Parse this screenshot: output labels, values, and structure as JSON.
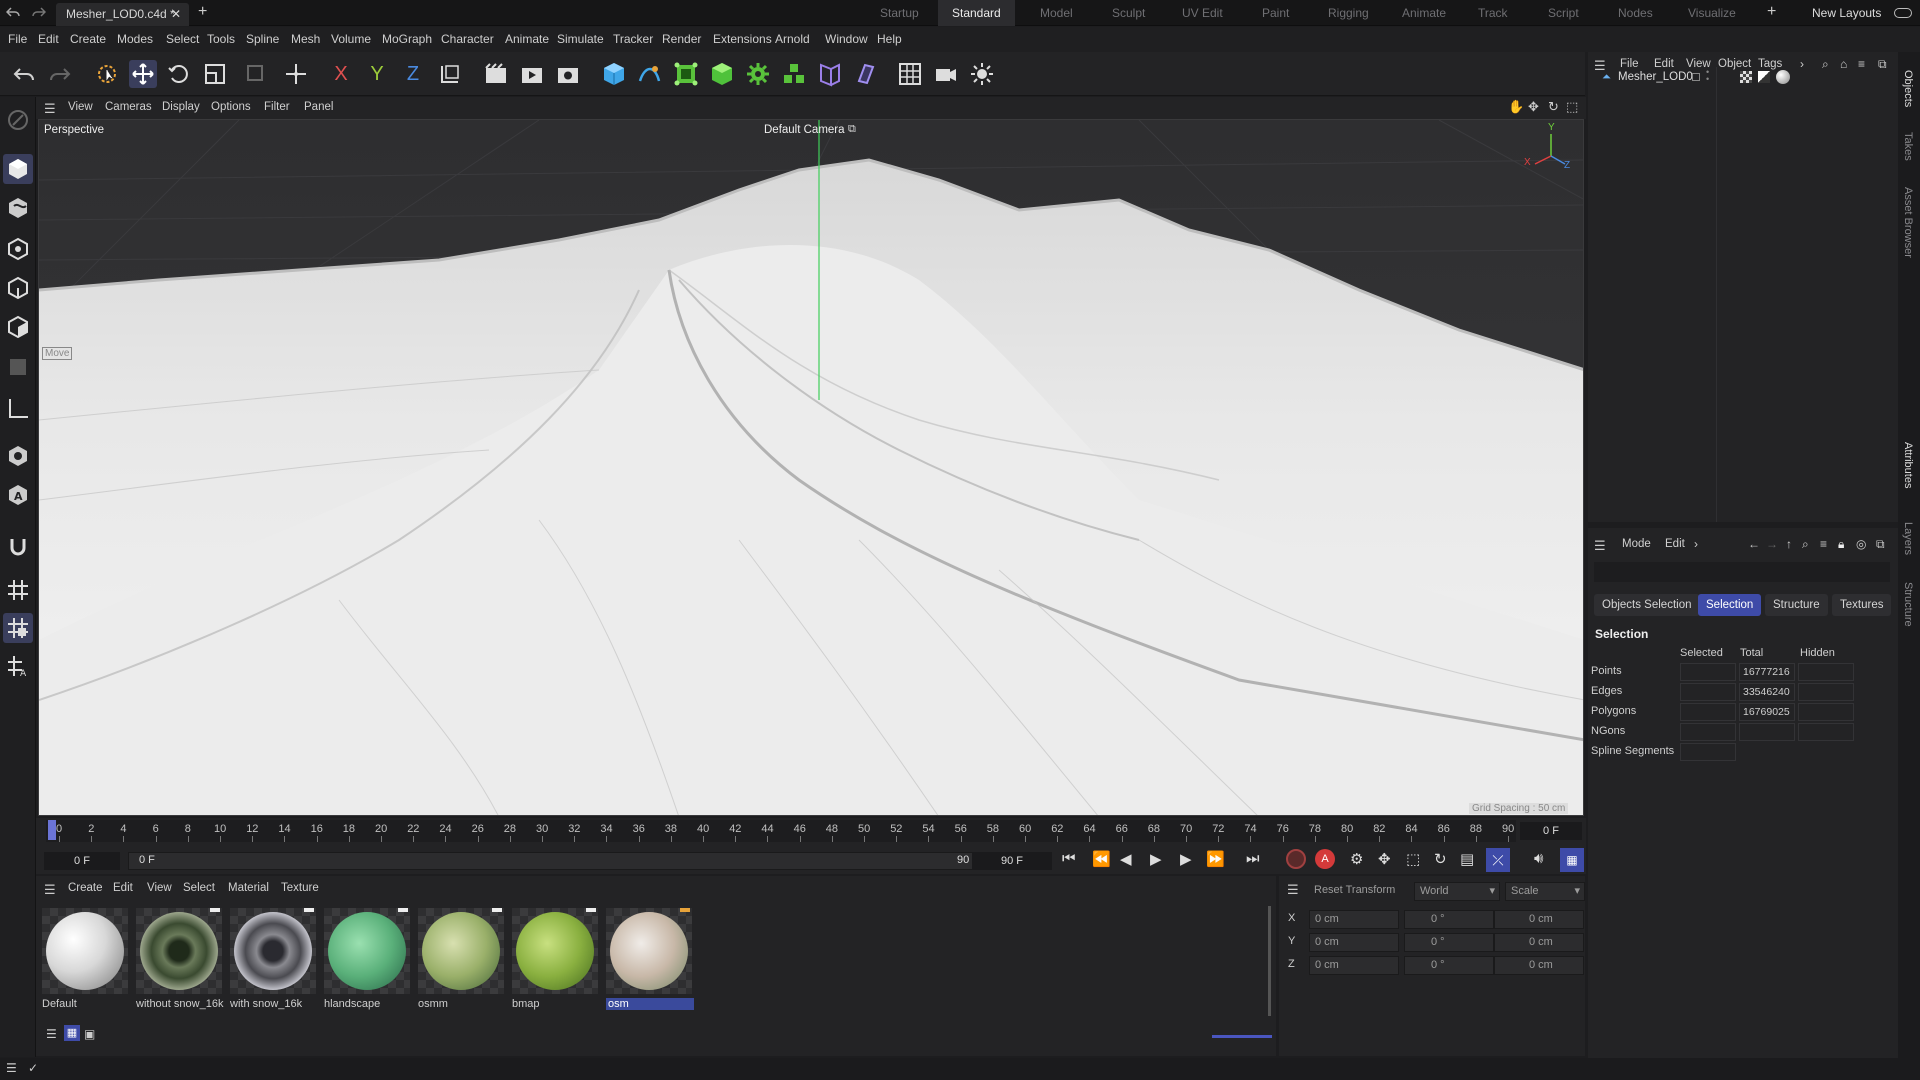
{
  "title_bar": {
    "document_tab": "Mesher_LOD0.c4d *",
    "layouts": [
      "Startup",
      "Standard",
      "Model",
      "Sculpt",
      "UV Edit",
      "Paint",
      "Rigging",
      "Animate",
      "Track",
      "Script",
      "Nodes",
      "Visualize"
    ],
    "active_layout": "Standard",
    "new_layouts": "New Layouts"
  },
  "menu": [
    "File",
    "Edit",
    "Create",
    "Modes",
    "Select",
    "Tools",
    "Spline",
    "Mesh",
    "Volume",
    "MoGraph",
    "Character",
    "Animate",
    "Simulate",
    "Tracker",
    "Render",
    "Extensions",
    "Arnold",
    "Window",
    "Help"
  ],
  "toolbar": {
    "axis_x": "X",
    "axis_y": "Y",
    "axis_z": "Z"
  },
  "viewport": {
    "menu": [
      "View",
      "Cameras",
      "Display",
      "Options",
      "Filter",
      "Panel"
    ],
    "projection": "Perspective",
    "camera": "Default Camera",
    "move_label": "Move",
    "grid_spacing": "Grid Spacing : 50 cm",
    "axis_labels": {
      "x": "X",
      "y": "Y",
      "z": "Z"
    }
  },
  "timeline": {
    "ticks": [
      "0",
      "2",
      "4",
      "6",
      "8",
      "10",
      "12",
      "14",
      "16",
      "18",
      "20",
      "22",
      "24",
      "26",
      "28",
      "30",
      "32",
      "34",
      "36",
      "38",
      "40",
      "42",
      "44",
      "46",
      "48",
      "50",
      "52",
      "54",
      "56",
      "58",
      "60",
      "62",
      "64",
      "66",
      "68",
      "70",
      "72",
      "74",
      "76",
      "78",
      "80",
      "82",
      "84",
      "86",
      "88",
      "90"
    ],
    "current_frame": "0 F",
    "start_frame": "0 F",
    "range_start": "0 F",
    "range_end": "90 F",
    "end_frame": "90 F",
    "autokey_label": "A"
  },
  "materials": {
    "menu": [
      "Create",
      "Edit",
      "View",
      "Select",
      "Material",
      "Texture"
    ],
    "items": [
      {
        "name": "Default"
      },
      {
        "name": "without snow_16k"
      },
      {
        "name": "with snow_16k"
      },
      {
        "name": "hlandscape"
      },
      {
        "name": "osmm"
      },
      {
        "name": "bmap"
      },
      {
        "name": "osm"
      }
    ],
    "selected": "osm"
  },
  "coordinates": {
    "reset": "Reset Transform",
    "space": "World",
    "mode": "Scale",
    "rows": [
      {
        "axis": "X",
        "pos": "0 cm",
        "rot": "0 °",
        "size": "0 cm"
      },
      {
        "axis": "Y",
        "pos": "0 cm",
        "rot": "0 °",
        "size": "0 cm"
      },
      {
        "axis": "Z",
        "pos": "0 cm",
        "rot": "0 °",
        "size": "0 cm"
      }
    ]
  },
  "objects_panel": {
    "menu": [
      "File",
      "Edit",
      "View",
      "Object",
      "Tags"
    ],
    "object_name": "Mesher_LOD0"
  },
  "attributes_panel": {
    "menu": [
      "Mode",
      "Edit"
    ],
    "tabs": [
      "Objects Selection",
      "Selection",
      "Structure",
      "Textures"
    ],
    "active_tab": "Selection",
    "section": "Selection",
    "columns": [
      "Selected",
      "Total",
      "Hidden"
    ],
    "rows": [
      {
        "label": "Points",
        "selected": "",
        "total": "16777216",
        "hidden": ""
      },
      {
        "label": "Edges",
        "selected": "",
        "total": "33546240",
        "hidden": ""
      },
      {
        "label": "Polygons",
        "selected": "",
        "total": "16769025",
        "hidden": ""
      },
      {
        "label": "NGons",
        "selected": "",
        "total": "",
        "hidden": ""
      },
      {
        "label": "Spline Segments",
        "selected": "",
        "total": "",
        "hidden": ""
      }
    ]
  },
  "side_tabs": [
    "Objects",
    "Takes",
    "Asset Browser",
    "Attributes",
    "Layers",
    "Structure"
  ],
  "colors": {
    "accent": "#3e4ba8",
    "panel": "#232325",
    "bg": "#1d1d1f"
  }
}
